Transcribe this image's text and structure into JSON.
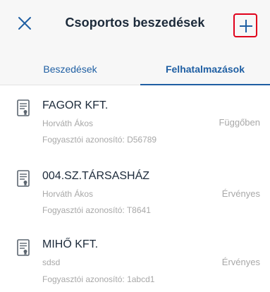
{
  "header": {
    "title": "Csoportos beszedések",
    "close_icon": "close-icon",
    "add_icon": "plus-icon",
    "accent_color": "#1f5fa3",
    "highlight_color": "#e0001b"
  },
  "tabs": [
    {
      "label": "Beszedések",
      "active": false
    },
    {
      "label": "Felhatalmazások",
      "active": true
    }
  ],
  "items": [
    {
      "name": "FAGOR KFT.",
      "person": "Horváth Ákos",
      "consumer_id": "Fogyasztói azonosító: D56789",
      "status": "Függőben"
    },
    {
      "name": "004.SZ.TÁRSASHÁZ",
      "person": "Horváth Ákos",
      "consumer_id": "Fogyasztói azonosító: T8641",
      "status": "Érvényes"
    },
    {
      "name": "MIHŐ KFT.",
      "person": "sdsd",
      "consumer_id": "Fogyasztói azonosító: 1abcd1",
      "status": "Érvényes"
    }
  ]
}
